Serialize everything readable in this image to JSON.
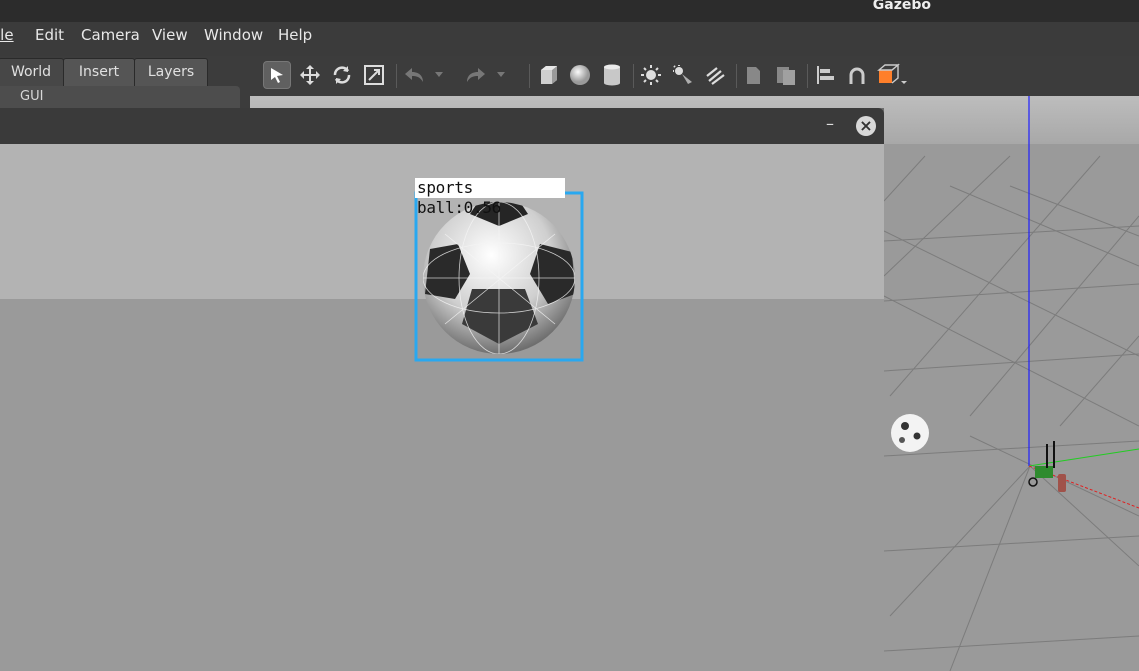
{
  "window": {
    "title": "Gazebo"
  },
  "menu": [
    {
      "label": "File",
      "visible": "ile"
    },
    {
      "label": "Edit"
    },
    {
      "label": "Camera"
    },
    {
      "label": "View"
    },
    {
      "label": "Window"
    },
    {
      "label": "Help"
    }
  ],
  "left_panel": {
    "tabs": [
      {
        "label": "World",
        "active": true
      },
      {
        "label": "Insert",
        "active": false
      },
      {
        "label": "Layers",
        "active": false
      }
    ],
    "tree_item": "GUI"
  },
  "toolbar": {
    "tools": [
      "select-mode-icon",
      "translate-mode-icon",
      "rotate-mode-icon",
      "scale-mode-icon",
      "undo-icon",
      "redo-icon",
      "box-icon",
      "sphere-icon",
      "cylinder-icon",
      "point-light-icon",
      "spot-light-icon",
      "directional-light-icon",
      "copy-icon",
      "paste-icon",
      "align-icon",
      "snap-icon",
      "view-angle-icon"
    ]
  },
  "image_viewer": {
    "minimize_label": "–",
    "close_label": "×",
    "detection": {
      "label": "sports ball:0.56",
      "class": "sports ball",
      "confidence": 0.56,
      "box_color": "#29a8f0"
    }
  },
  "colors": {
    "title_bar": "#2c2c2c",
    "menu_bar": "#3b3b3b",
    "panel": "#3c3c3c",
    "scene_floor": "#9a9a9a",
    "scene_sky": "#b3b3b3",
    "accent_orange": "#ff7f2a"
  }
}
